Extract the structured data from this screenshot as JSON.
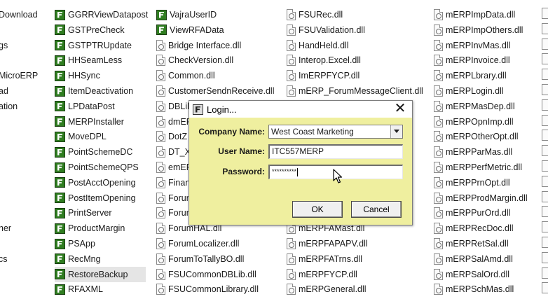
{
  "explorer": {
    "col0": [
      "Download",
      "",
      "gs",
      "",
      "MicroERP",
      "ad",
      "ation",
      "",
      "",
      "",
      "",
      "",
      "",
      "",
      "her",
      "",
      "cs",
      "",
      "",
      ""
    ],
    "col1": [
      "GGRRViewDatapost",
      "GSTPreCheck",
      "GSTPTRUpdate",
      "HHSeamLess",
      "HHSync",
      "ItemDeactivation",
      "LPDataPost",
      "MERPInstaller",
      "MoveDPL",
      "PointSchemeDC",
      "PointSchemeQPS",
      "PostAcctOpening",
      "PostItemOpening",
      "PrintServer",
      "ProductMargin",
      "PSApp",
      "RecMng",
      "RestoreBackup",
      "RFAXML"
    ],
    "col2": [
      "VajraUserID",
      "ViewRFAData",
      "Bridge Interface.dll",
      "CheckVersion.dll",
      "Common.dll",
      "CustomerSendnReceive.dll",
      "DBLib",
      "dmEF",
      "DotZ",
      "DT_X",
      "emEF",
      "Finan",
      "Forun",
      "Forun",
      "ForumHAL.dll",
      "ForumLocalizer.dll",
      "ForumToTallyBO.dll",
      "FSUCommonDBLib.dll",
      "FSUCommonLibrary.dll"
    ],
    "col3": [
      "FSURec.dll",
      "FSUValidation.dll",
      "HandHeld.dll",
      "Interop.Excel.dll",
      "ImERPFYCP.dll",
      "mERP_ForumMessageClient.dll",
      "",
      "",
      "",
      "",
      "",
      "",
      "",
      "",
      "mERPFAMast.dll",
      "mERPFAPAPV.dll",
      "mERPFATrns.dll",
      "mERPFYCP.dll",
      "mERPGeneral.dll"
    ],
    "col4": [
      "mERPImpData.dll",
      "mERPImpOthers.dll",
      "mERPInvMas.dll",
      "mERPInvoice.dll",
      "mERPLbrary.dll",
      "mERPLogin.dll",
      "mERPMasDep.dll",
      "mERPOpnImp.dll",
      "mERPOtherOpt.dll",
      "mERPParMas.dll",
      "mERPPerfMetric.dll",
      "mERPPrnOpt.dll",
      "mERPProdMargin.dll",
      "mERPPurOrd.dll",
      "mERPRecDoc.dll",
      "mERPRetSal.dll",
      "mERPSalAmd.dll",
      "mERPSalOrd.dll",
      "mERPSchMas.dll"
    ],
    "selected_item": "RestoreBackup"
  },
  "dialog": {
    "title": "Login...",
    "close_glyph": "✕",
    "company_label": "Company Name:",
    "company_value": "West Coast Marketing",
    "user_label": "User Name:",
    "user_value": "ITC557MERP",
    "password_label": "Password:",
    "password_value": "**********",
    "ok_label": "OK",
    "cancel_label": "Cancel",
    "background_color": "#efef9f"
  },
  "icons": {
    "exe": "application-exe-icon",
    "dll": "dll-file-icon",
    "cursor": "mouse-pointer-icon"
  }
}
